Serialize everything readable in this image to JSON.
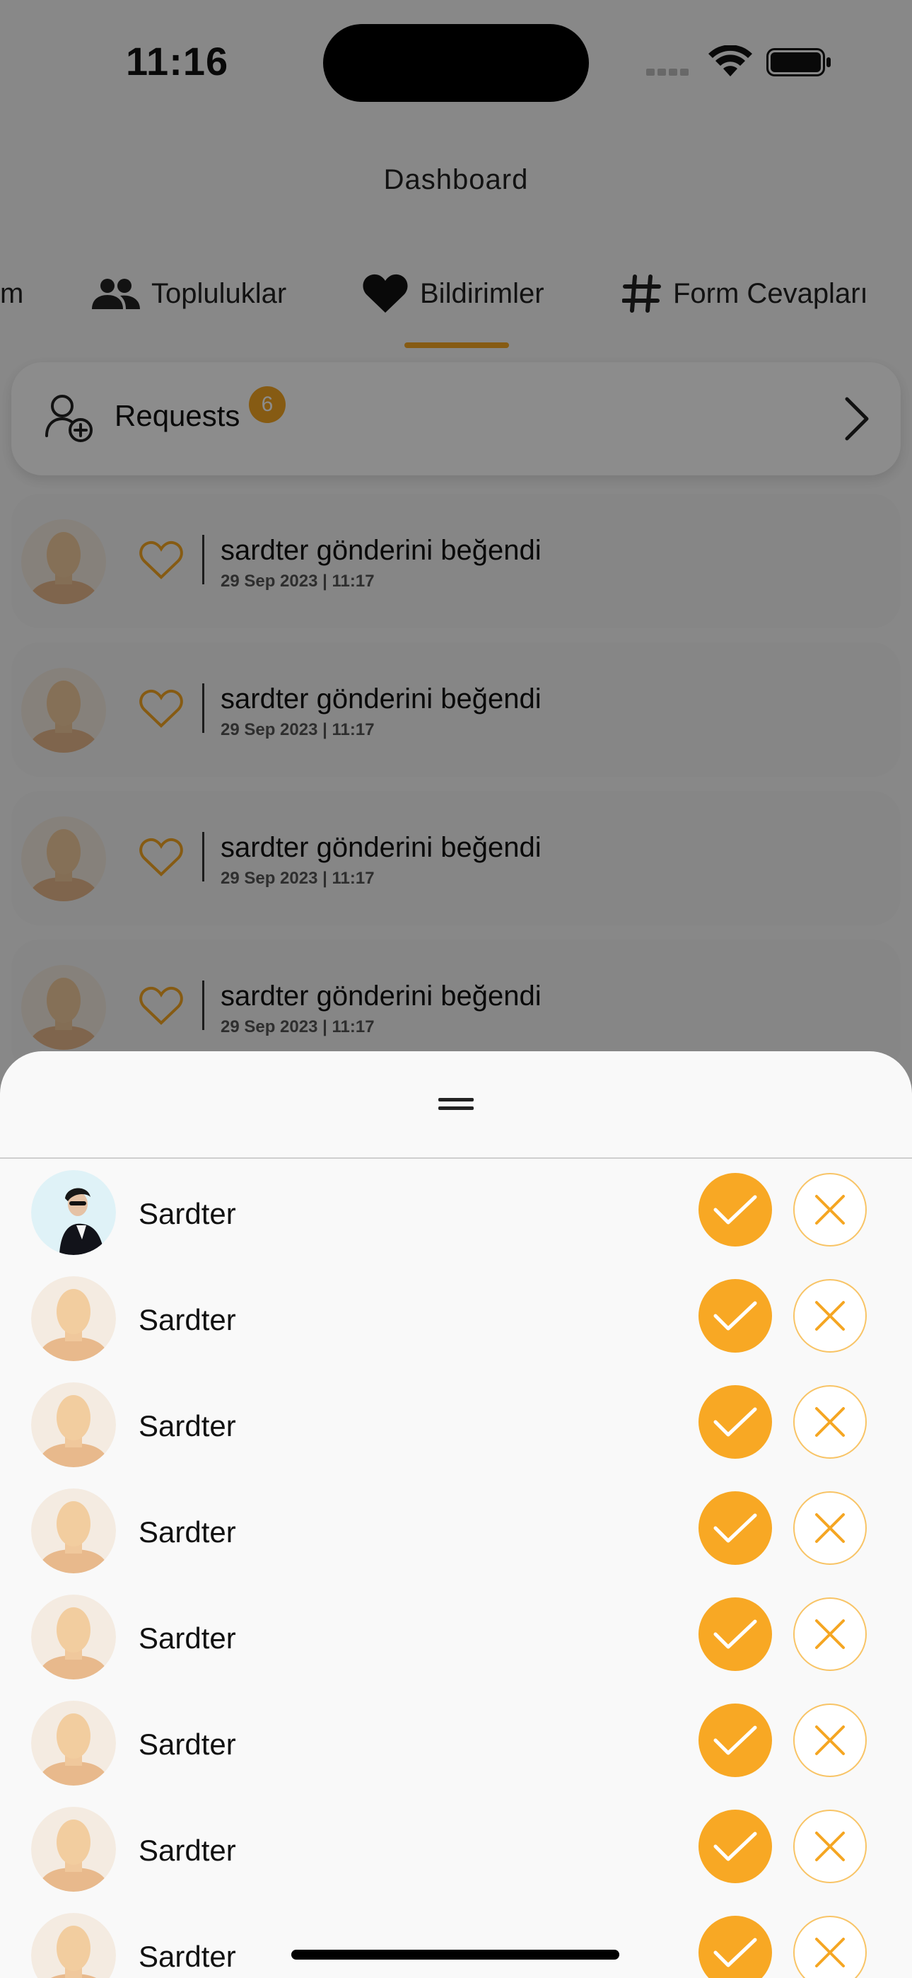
{
  "status_bar": {
    "time": "11:16"
  },
  "header": {
    "title": "Dashboard"
  },
  "tabs": [
    {
      "label": "m",
      "icon": "none"
    },
    {
      "label": "Topluluklar",
      "icon": "people-icon"
    },
    {
      "label": "Bildirimler",
      "icon": "heart-icon",
      "active": true
    },
    {
      "label": "Form Cevapları",
      "icon": "hashtag-icon"
    }
  ],
  "requests": {
    "label": "Requests",
    "count": "6"
  },
  "notifications": [
    {
      "text": "sardter gönderini beğendi",
      "time": "29 Sep 2023 | 11:17"
    },
    {
      "text": "sardter gönderini beğendi",
      "time": "29 Sep 2023 | 11:17"
    },
    {
      "text": "sardter gönderini beğendi",
      "time": "29 Sep 2023 | 11:17"
    },
    {
      "text": "sardter gönderini beğendi",
      "time": "29 Sep 2023 | 11:17"
    }
  ],
  "sheet": {
    "rows": [
      {
        "name": "Sardter",
        "avatar": "photo"
      },
      {
        "name": "Sardter",
        "avatar": "placeholder"
      },
      {
        "name": "Sardter",
        "avatar": "placeholder"
      },
      {
        "name": "Sardter",
        "avatar": "placeholder"
      },
      {
        "name": "Sardter",
        "avatar": "placeholder"
      },
      {
        "name": "Sardter",
        "avatar": "placeholder"
      },
      {
        "name": "Sardter",
        "avatar": "placeholder"
      },
      {
        "name": "Sardter",
        "avatar": "placeholder"
      }
    ]
  },
  "colors": {
    "accent": "#f8a824",
    "scrim": "rgba(0,0,0,0.45)"
  }
}
